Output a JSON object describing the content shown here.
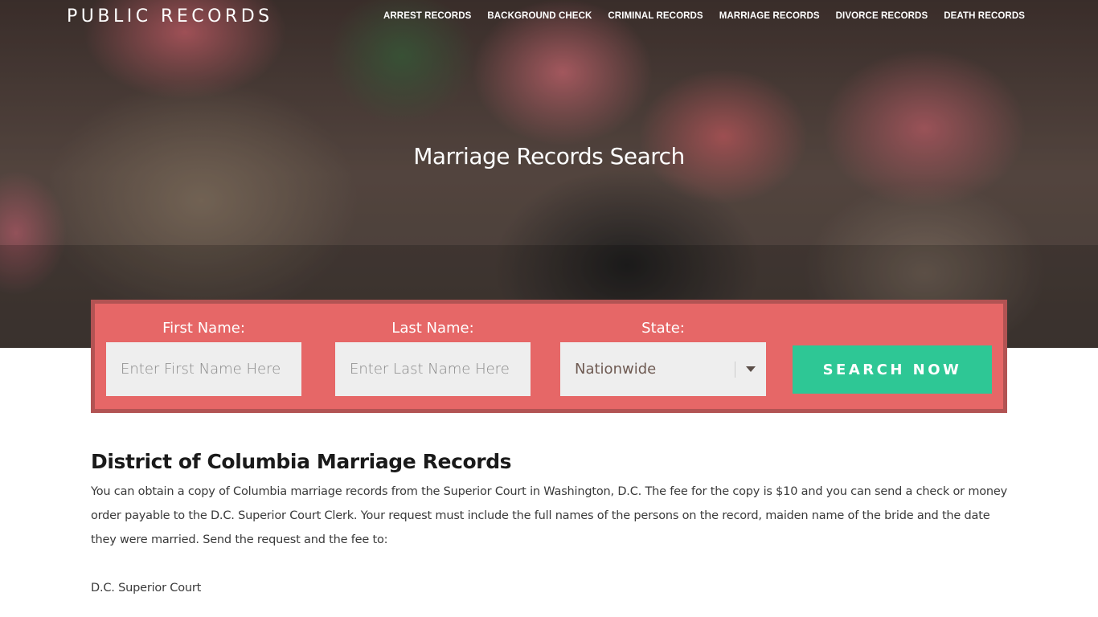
{
  "site": {
    "logo": "PUBLIC RECORDS"
  },
  "nav": {
    "items": [
      {
        "label": "ARREST RECORDS"
      },
      {
        "label": "BACKGROUND CHECK"
      },
      {
        "label": "CRIMINAL RECORDS"
      },
      {
        "label": "MARRIAGE RECORDS"
      },
      {
        "label": "DIVORCE RECORDS"
      },
      {
        "label": "DEATH RECORDS"
      }
    ]
  },
  "hero": {
    "title": "Marriage Records Search"
  },
  "search": {
    "first_name_label": "First Name:",
    "first_name_placeholder": "Enter First Name Here",
    "first_name_value": "",
    "last_name_label": "Last Name:",
    "last_name_placeholder": "Enter Last Name Here",
    "last_name_value": "",
    "state_label": "State:",
    "state_selected": "Nationwide",
    "button_label": "SEARCH NOW",
    "colors": {
      "panel": "#e66767",
      "panel_border": "#b25353",
      "button": "#2ec795"
    }
  },
  "article": {
    "heading": "District of Columbia Marriage Records",
    "paragraph": "You can obtain a copy of Columbia marriage records from the Superior Court in Washington, D.C. The fee for the copy is $10 and you can send a check or money order payable to the D.C. Superior Court Clerk. Your request must include the full names of the persons on the record, maiden name of the bride and the date they were married. Send the request and the fee to:",
    "address_line_1": "D.C. Superior Court"
  }
}
